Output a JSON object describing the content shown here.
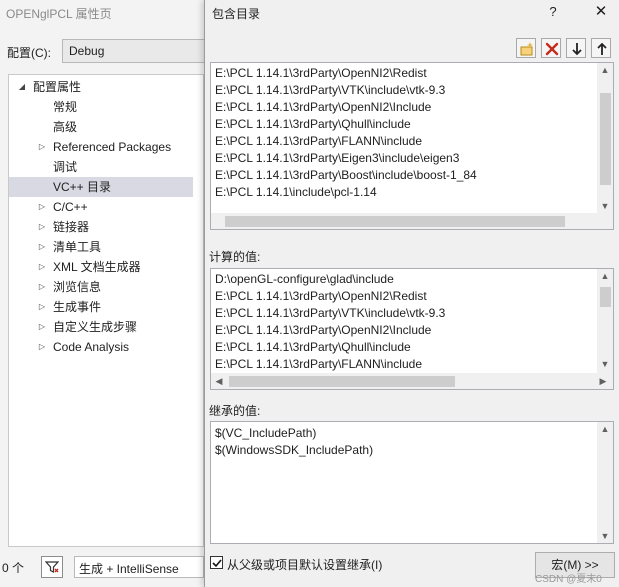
{
  "background_window": {
    "title": "OPENglPCL 属性页",
    "config_label": "配置(C):",
    "config_value": "Debug",
    "tree": {
      "root": "配置属性",
      "items": [
        {
          "label": "常规",
          "expandable": false
        },
        {
          "label": "高级",
          "expandable": false
        },
        {
          "label": "Referenced Packages",
          "expandable": true
        },
        {
          "label": "调试",
          "expandable": false
        },
        {
          "label": "VC++ 目录",
          "expandable": false,
          "selected": true
        },
        {
          "label": "C/C++",
          "expandable": true
        },
        {
          "label": "链接器",
          "expandable": true
        },
        {
          "label": "清单工具",
          "expandable": true
        },
        {
          "label": "XML 文档生成器",
          "expandable": true
        },
        {
          "label": "浏览信息",
          "expandable": true
        },
        {
          "label": "生成事件",
          "expandable": true
        },
        {
          "label": "自定义生成步骤",
          "expandable": true
        },
        {
          "label": "Code Analysis",
          "expandable": true
        }
      ]
    },
    "status": {
      "error_count": "0 个",
      "build_filter": "生成 + IntelliSense"
    }
  },
  "dialog": {
    "title": "包含目录",
    "help": "?",
    "close": "✕",
    "toolbar": {
      "icons": [
        "new-line-icon",
        "delete-icon",
        "move-down-icon",
        "move-up-icon"
      ]
    },
    "entries": [
      "E:\\PCL 1.14.1\\3rdParty\\OpenNI2\\Redist",
      "E:\\PCL 1.14.1\\3rdParty\\VTK\\include\\vtk-9.3",
      "E:\\PCL 1.14.1\\3rdParty\\OpenNI2\\Include",
      "E:\\PCL 1.14.1\\3rdParty\\Qhull\\include",
      "E:\\PCL 1.14.1\\3rdParty\\FLANN\\include",
      "E:\\PCL 1.14.1\\3rdParty\\Eigen3\\include\\eigen3",
      "E:\\PCL 1.14.1\\3rdParty\\Boost\\include\\boost-1_84",
      "E:\\PCL 1.14.1\\include\\pcl-1.14"
    ],
    "evaluated_label": "计算的值:",
    "evaluated": [
      "D:\\openGL-configure\\glad\\include",
      "E:\\PCL 1.14.1\\3rdParty\\OpenNI2\\Redist",
      "E:\\PCL 1.14.1\\3rdParty\\VTK\\include\\vtk-9.3",
      "E:\\PCL 1.14.1\\3rdParty\\OpenNI2\\Include",
      "E:\\PCL 1.14.1\\3rdParty\\Qhull\\include",
      "E:\\PCL 1.14.1\\3rdParty\\FLANN\\include"
    ],
    "inherited_label": "继承的值:",
    "inherited": [
      "$(VC_IncludePath)",
      "$(WindowsSDK_IncludePath)"
    ],
    "inherit_checkbox": {
      "label": "从父级或项目默认设置继承(I)",
      "checked": true
    },
    "macro_button": "宏(M) >>",
    "watermark": "CSDN @夏末0"
  },
  "colors": {
    "accent_new": "#e8b23a",
    "delete_red": "#c42b1c",
    "selection": "#d9d9e4"
  }
}
